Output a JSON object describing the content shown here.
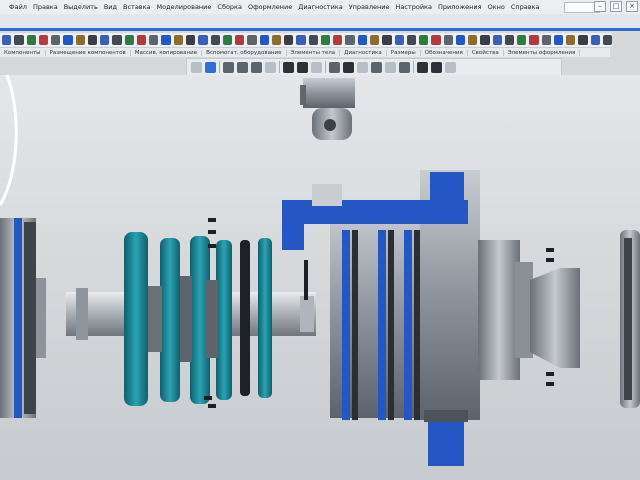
{
  "menubar": {
    "items": [
      "Файл",
      "Правка",
      "Выделить",
      "Вид",
      "Вставка",
      "Моделирование",
      "Сборка",
      "Оформление",
      "Диагностика",
      "Управление",
      "Настройка",
      "Приложения",
      "Окно",
      "Справка"
    ],
    "window_controls": [
      "–",
      "□",
      "×"
    ]
  },
  "toolbar_labels": [
    "Компоненты",
    "Размещение компонентов",
    "Массив, копирование",
    "Вспомогат. оборудование",
    "Элементы тела",
    "Диагностика",
    "Размеры",
    "Обозначения",
    "Свойства",
    "Элементы оформления"
  ],
  "colors": {
    "accent": "#2d6bd0",
    "part_blue": "#2457c4",
    "turbine_teal": "#1d8fa0",
    "metal_gray": "#9aa0a8",
    "background": "#d6d8dc"
  },
  "icons": [
    "compass-icon",
    "select-icon",
    "rotate-icon",
    "pan-icon",
    "zoom-icon",
    "orient-icon",
    "display-mode-icon",
    "section-icon",
    "filter-icon"
  ]
}
